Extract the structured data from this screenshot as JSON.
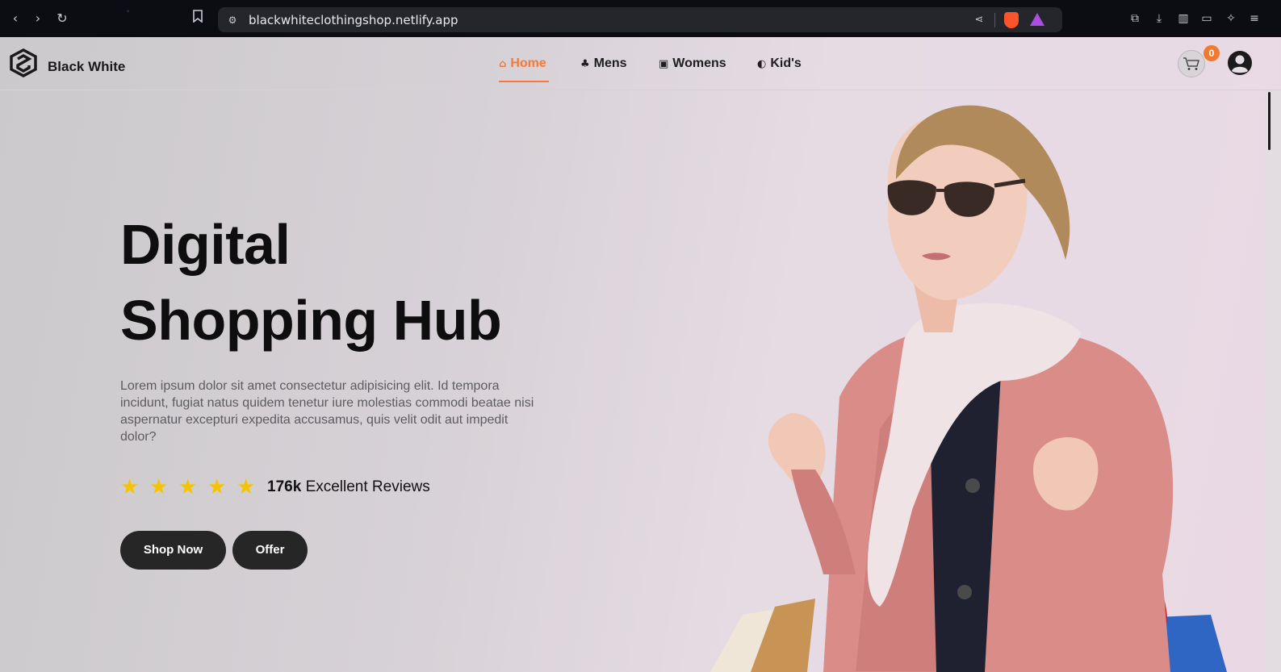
{
  "browser": {
    "url": "blackwhiteclothingshop.netlify.app",
    "nav_icons": [
      "back-icon",
      "forward-icon",
      "reload-icon",
      "bookmark-icon"
    ],
    "toolbar_icons": [
      "extensions-icon",
      "downloads-icon",
      "sidebar-icon",
      "wallet-icon",
      "leo-ai-icon",
      "menu-icon"
    ]
  },
  "header": {
    "brand": "Black White",
    "nav": [
      {
        "label": "Home",
        "icon": "home-icon",
        "active": true
      },
      {
        "label": "Mens",
        "icon": "mens-icon",
        "active": false
      },
      {
        "label": "Womens",
        "icon": "womens-icon",
        "active": false
      },
      {
        "label": "Kid's",
        "icon": "kids-icon",
        "active": false
      }
    ],
    "cart_count": "0"
  },
  "hero": {
    "title_line1": "Digital",
    "title_line2": "Shopping Hub",
    "description": "Lorem ipsum dolor sit amet consectetur adipisicing elit. Id tempora incidunt, fugiat natus quidem tenetur iure molestias commodi beatae nisi aspernatur excepturi expedita accusamus, quis velit odit aut impedit dolor?",
    "rating_stars": 5,
    "reviews_count": "176k",
    "reviews_label": "Excellent Reviews",
    "shop_button": "Shop Now",
    "offer_button": "Offer"
  },
  "colors": {
    "accent": "#f27a3a",
    "button_bg": "#262626",
    "star": "#f5c400"
  }
}
